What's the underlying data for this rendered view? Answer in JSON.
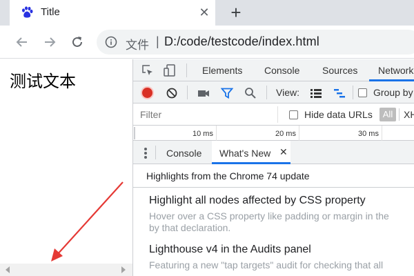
{
  "browser": {
    "tab": {
      "title": "Title",
      "favicon": "baidu-paw-icon",
      "close": "✕"
    },
    "new_tab": "+",
    "omnibox": {
      "info_icon": "info-icon",
      "scheme_label": "文件",
      "separator": "|",
      "url": "D:/code/testcode/index.html"
    }
  },
  "page": {
    "text": "测试文本",
    "annotation": {
      "color": "#e53935"
    }
  },
  "devtools": {
    "tabs": [
      "Elements",
      "Console",
      "Sources",
      "Network"
    ],
    "active_tab": "Network",
    "network_toolbar": {
      "view_label": "View:",
      "group_by_label": "Group by"
    },
    "filter": {
      "placeholder": "Filter",
      "hide_data_urls_label": "Hide data URLs",
      "all_label": "All",
      "xhr_label": "XHR"
    },
    "timeline_ticks": [
      "10 ms",
      "20 ms",
      "30 ms"
    ],
    "drawer": {
      "tabs": [
        "Console",
        "What's New"
      ],
      "active_tab": "What's New",
      "close": "✕"
    },
    "whats_new": {
      "heading": "Highlights from the Chrome 74 update",
      "items": [
        {
          "title": "Highlight all nodes affected by CSS property",
          "description_line1": "Hover over a CSS property like padding or margin in the",
          "description_line2": "by that declaration."
        },
        {
          "title": "Lighthouse v4 in the Audits panel",
          "description_line1": "Featuring a new \"tap targets\" audit for checking that all"
        }
      ]
    }
  },
  "colors": {
    "accent": "#1a73e8",
    "record": "#d93025",
    "tab_strip": "#dee1e6"
  }
}
